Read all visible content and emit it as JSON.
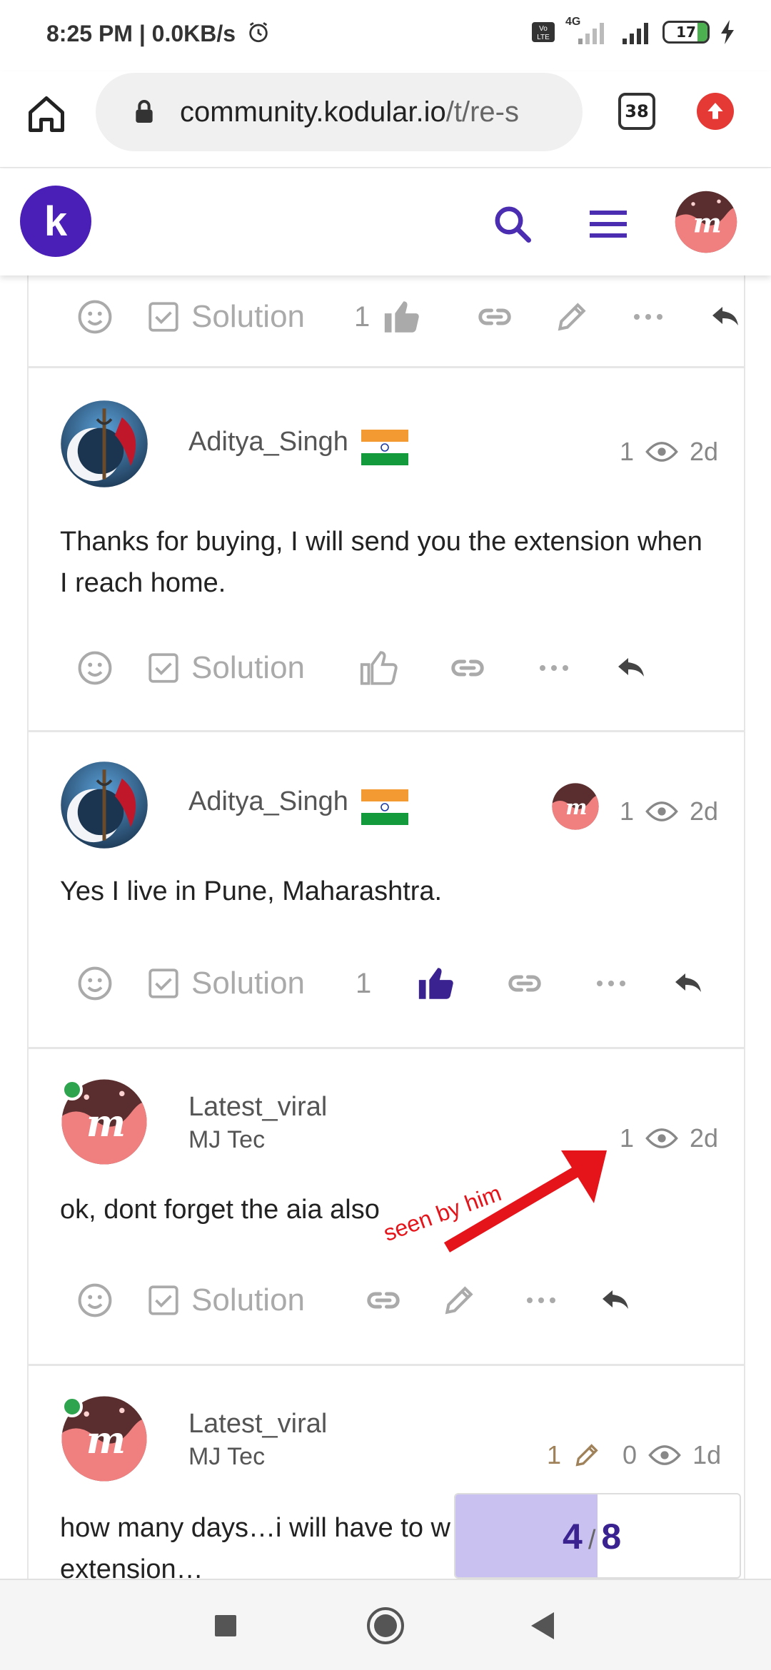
{
  "status_bar": {
    "time": "8:25 PM | 0.0KB/s",
    "battery": "17",
    "network": "4G"
  },
  "browser": {
    "url_domain": "community.kodular.io",
    "url_path": "/t/re-s",
    "tab_count": "38"
  },
  "site": {
    "logo_letter": "k"
  },
  "action_labels": {
    "solution": "Solution"
  },
  "posts": [
    {
      "likes": "1"
    },
    {
      "author": "Aditya_Singh",
      "views": "1",
      "age": "2d",
      "text": "Thanks for buying, I will send you the extension when I reach home."
    },
    {
      "author": "Aditya_Singh",
      "views": "1",
      "age": "2d",
      "text": "Yes I live in Pune, Maharashtra.",
      "likes": "1"
    },
    {
      "author": "Latest_viral",
      "subtitle": "MJ Tec",
      "views": "1",
      "age": "2d",
      "text": "ok, dont forget the aia also"
    },
    {
      "author": "Latest_viral",
      "subtitle": "MJ Tec",
      "edits": "1",
      "views": "0",
      "age": "1d",
      "text_line1": "how many days…i will have to w",
      "text_line2": "extension…"
    }
  ],
  "annotation": {
    "text": "seen by him"
  },
  "timeline": {
    "current": "4",
    "separator": "/",
    "total": "8",
    "progress": 0.5
  },
  "colors": {
    "accent": "#3a2290",
    "liked": "#3a2290",
    "annotation": "#e5141a",
    "online": "#2ea44f"
  }
}
